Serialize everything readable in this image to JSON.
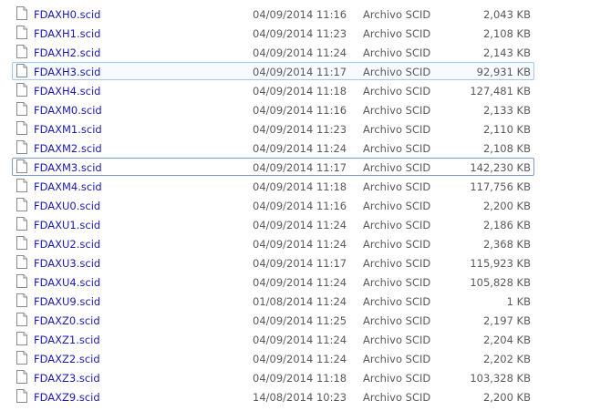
{
  "files": [
    {
      "name": "FDAXH0.scid",
      "date": "04/09/2014 11:16",
      "type": "Archivo SCID",
      "size": "2,043 KB"
    },
    {
      "name": "FDAXH1.scid",
      "date": "04/09/2014 11:23",
      "type": "Archivo SCID",
      "size": "2,108 KB"
    },
    {
      "name": "FDAXH2.scid",
      "date": "04/09/2014 11:24",
      "type": "Archivo SCID",
      "size": "2,143 KB"
    },
    {
      "name": "FDAXH3.scid",
      "date": "04/09/2014 11:17",
      "type": "Archivo SCID",
      "size": "92,931 KB",
      "state": "hovered"
    },
    {
      "name": "FDAXH4.scid",
      "date": "04/09/2014 11:18",
      "type": "Archivo SCID",
      "size": "127,481 KB"
    },
    {
      "name": "FDAXM0.scid",
      "date": "04/09/2014 11:16",
      "type": "Archivo SCID",
      "size": "2,133 KB"
    },
    {
      "name": "FDAXM1.scid",
      "date": "04/09/2014 11:23",
      "type": "Archivo SCID",
      "size": "2,110 KB"
    },
    {
      "name": "FDAXM2.scid",
      "date": "04/09/2014 11:24",
      "type": "Archivo SCID",
      "size": "2,108 KB"
    },
    {
      "name": "FDAXM3.scid",
      "date": "04/09/2014 11:17",
      "type": "Archivo SCID",
      "size": "142,230 KB",
      "state": "focused"
    },
    {
      "name": "FDAXM4.scid",
      "date": "04/09/2014 11:18",
      "type": "Archivo SCID",
      "size": "117,756 KB"
    },
    {
      "name": "FDAXU0.scid",
      "date": "04/09/2014 11:16",
      "type": "Archivo SCID",
      "size": "2,200 KB"
    },
    {
      "name": "FDAXU1.scid",
      "date": "04/09/2014 11:24",
      "type": "Archivo SCID",
      "size": "2,186 KB"
    },
    {
      "name": "FDAXU2.scid",
      "date": "04/09/2014 11:24",
      "type": "Archivo SCID",
      "size": "2,368 KB"
    },
    {
      "name": "FDAXU3.scid",
      "date": "04/09/2014 11:17",
      "type": "Archivo SCID",
      "size": "115,923 KB"
    },
    {
      "name": "FDAXU4.scid",
      "date": "04/09/2014 11:24",
      "type": "Archivo SCID",
      "size": "105,828 KB"
    },
    {
      "name": "FDAXU9.scid",
      "date": "01/08/2014 11:24",
      "type": "Archivo SCID",
      "size": "1 KB"
    },
    {
      "name": "FDAXZ0.scid",
      "date": "04/09/2014 11:25",
      "type": "Archivo SCID",
      "size": "2,197 KB"
    },
    {
      "name": "FDAXZ1.scid",
      "date": "04/09/2014 11:24",
      "type": "Archivo SCID",
      "size": "2,204 KB"
    },
    {
      "name": "FDAXZ2.scid",
      "date": "04/09/2014 11:24",
      "type": "Archivo SCID",
      "size": "2,202 KB"
    },
    {
      "name": "FDAXZ3.scid",
      "date": "04/09/2014 11:18",
      "type": "Archivo SCID",
      "size": "103,328 KB"
    },
    {
      "name": "FDAXZ9.scid",
      "date": "14/08/2014 10:23",
      "type": "Archivo SCID",
      "size": "2,200 KB"
    }
  ],
  "icons": {
    "file": "document-icon"
  },
  "colors": {
    "name_text": "#1a1ab0",
    "hover_border": "#a8c8e8",
    "focus_border": "#7a9cc6"
  }
}
